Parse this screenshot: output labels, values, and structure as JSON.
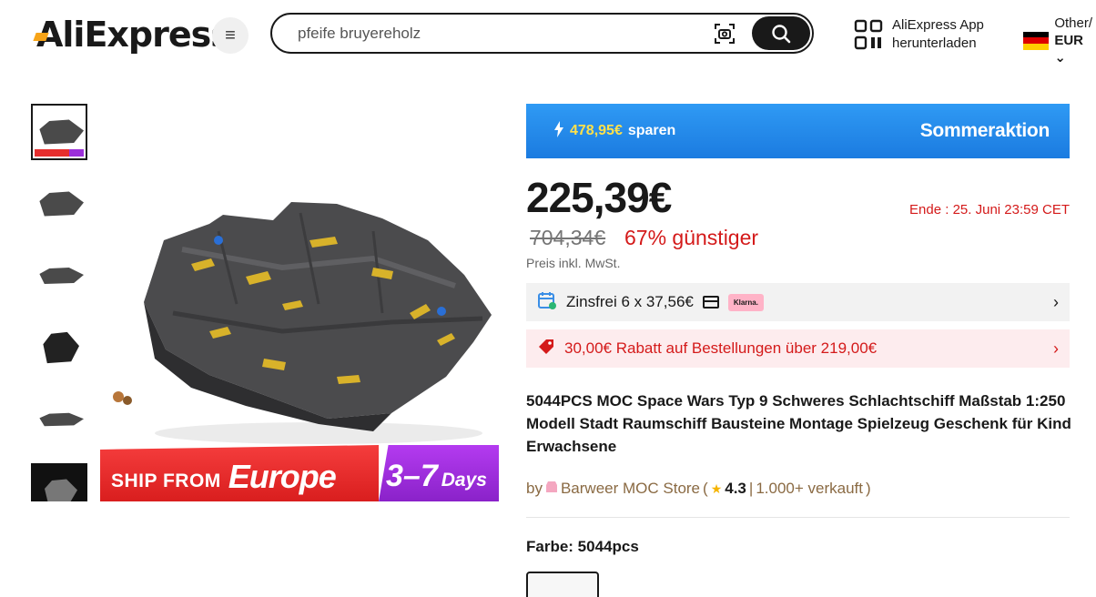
{
  "header": {
    "logo": "AliExpress",
    "search": {
      "value": "pfeife bruyereholz",
      "placeholder": ""
    },
    "app_download": {
      "line1": "AliExpress App",
      "line2": "herunterladen"
    },
    "locale": {
      "region": "Other/",
      "currency": "EUR"
    }
  },
  "gallery": {
    "banner": {
      "ship_from": "SHIP FROM",
      "origin": "Europe",
      "days_num": "3–7",
      "days_label": "Days"
    },
    "thumbnail_count": 6
  },
  "product": {
    "promo": {
      "save_amount": "478,95€",
      "save_label": "sparen",
      "title": "Sommeraktion"
    },
    "price": "225,39€",
    "ende_label": "Ende :",
    "ende_value": "25. Juni 23:59 CET",
    "old_price": "704,34€",
    "discount": "67% günstiger",
    "vat_note": "Preis inkl. MwSt.",
    "installments": {
      "text": "Zinsfrei 6 x 37,56€",
      "badge": "Klarna."
    },
    "coupon": {
      "text": "30,00€ Rabatt auf Bestellungen über 219,00€"
    },
    "title": "5044PCS MOC Space Wars Typ 9 Schweres Schlachtschiff Maßstab 1:250 Modell Stadt Raumschiff Bausteine Montage Spielzeug Geschenk für Kind Erwachsene",
    "store": {
      "by": "by",
      "name": "Barweer MOC Store",
      "open_paren": "(",
      "rating": "4.3",
      "sep": "|",
      "sold": "1.000+ verkauft",
      "close_paren": ")"
    },
    "color_label": "Farbe: 5044pcs"
  },
  "colors": {
    "accent_red": "#d41a1a",
    "promo_blue": "#1b7be0",
    "banner_red": "#e62e2e",
    "banner_purple": "#9b2fd9",
    "store_brown": "#8a6a43"
  }
}
